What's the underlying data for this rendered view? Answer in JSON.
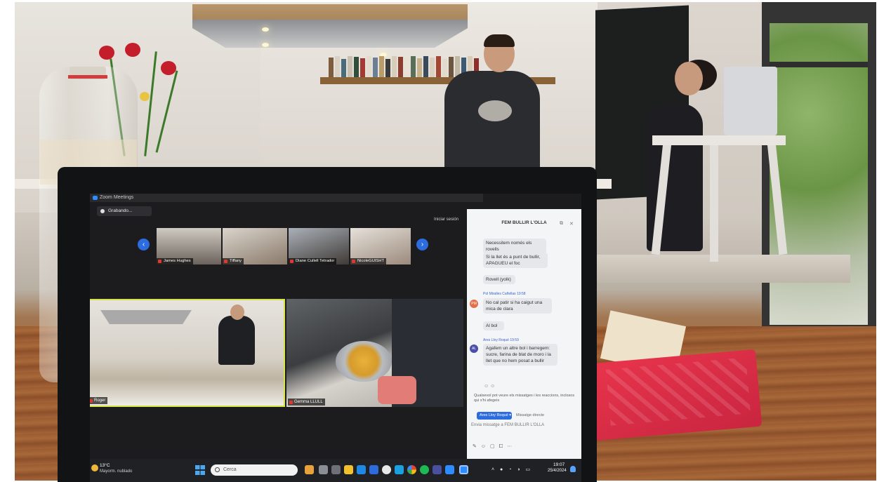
{
  "zoom": {
    "window_title": "Zoom Meetings",
    "recording_label": "Grabando...",
    "start_label": "Iniciar sesión"
  },
  "strip_participants": [
    {
      "name": "James Hughes"
    },
    {
      "name": "Tiffany"
    },
    {
      "name": "Diane Cullell Tetrador"
    },
    {
      "name": "NicoleGUISHT"
    }
  ],
  "main_tiles": [
    {
      "name": "Roger"
    },
    {
      "name": "Gemma LLULL"
    }
  ],
  "nav": {
    "prev": "‹",
    "next": "›"
  },
  "chat": {
    "title": "FEM BULLIR L'OLLA",
    "messages": [
      {
        "sender": "",
        "text": "Necessitem només els rovells"
      },
      {
        "sender": "",
        "text": "Si la llet és a punt de bullir, APAGUEU el foc"
      },
      {
        "sender": "",
        "text": "Rovell (yolk)"
      },
      {
        "sender": "Pol Miralles Cañellas  19:58",
        "initials": "PM",
        "text": "No cal patir si ha caigut una mica de clara"
      },
      {
        "sender": "",
        "text": "Al bol"
      },
      {
        "sender": "Ares Lloy Roqué  19:59",
        "initials": "AL",
        "text": "Agafem un altre bol i barregem: sucre, farina de blat de moro i la llet que no hem posat a bullir"
      }
    ],
    "reply_hint": "Qualsevol pot veure els missatges i les reaccions, inclosos qui s'hi afegeix",
    "to_label": "Ares Lloy Roqué",
    "direct_label": "Missatge directe",
    "compose_placeholder": "Envia missatge a FEM BULLIR L'OLLA"
  },
  "taskbar": {
    "temperature": "13°C",
    "weather": "Mayorm. nublado",
    "search_placeholder": "Cerca",
    "time": "19:07",
    "date": "25/4/2024"
  }
}
